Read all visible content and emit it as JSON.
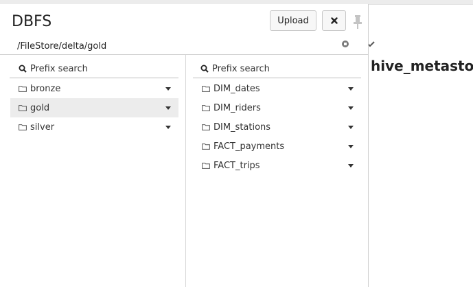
{
  "modal": {
    "title": "DBFS",
    "upload_label": "Upload",
    "path": "/FileStore/delta/gold"
  },
  "background": {
    "heading": "hive_metastore"
  },
  "columns": [
    {
      "search_placeholder": "Prefix search",
      "items": [
        {
          "label": "bronze",
          "selected": false
        },
        {
          "label": "gold",
          "selected": true
        },
        {
          "label": "silver",
          "selected": false
        }
      ]
    },
    {
      "search_placeholder": "Prefix search",
      "items": [
        {
          "label": "DIM_dates",
          "selected": false
        },
        {
          "label": "DIM_riders",
          "selected": false
        },
        {
          "label": "DIM_stations",
          "selected": false
        },
        {
          "label": "FACT_payments",
          "selected": false
        },
        {
          "label": "FACT_trips",
          "selected": false
        }
      ]
    }
  ],
  "icons": {
    "close": "close-icon",
    "pin": "pin-icon",
    "stop": "stop-icon",
    "search": "search-icon",
    "folder": "folder-icon",
    "caret": "caret-down-icon",
    "chevron": "chevron-down-icon"
  },
  "colors": {
    "selected_row": "#ececec",
    "border": "#cfcfcf"
  }
}
